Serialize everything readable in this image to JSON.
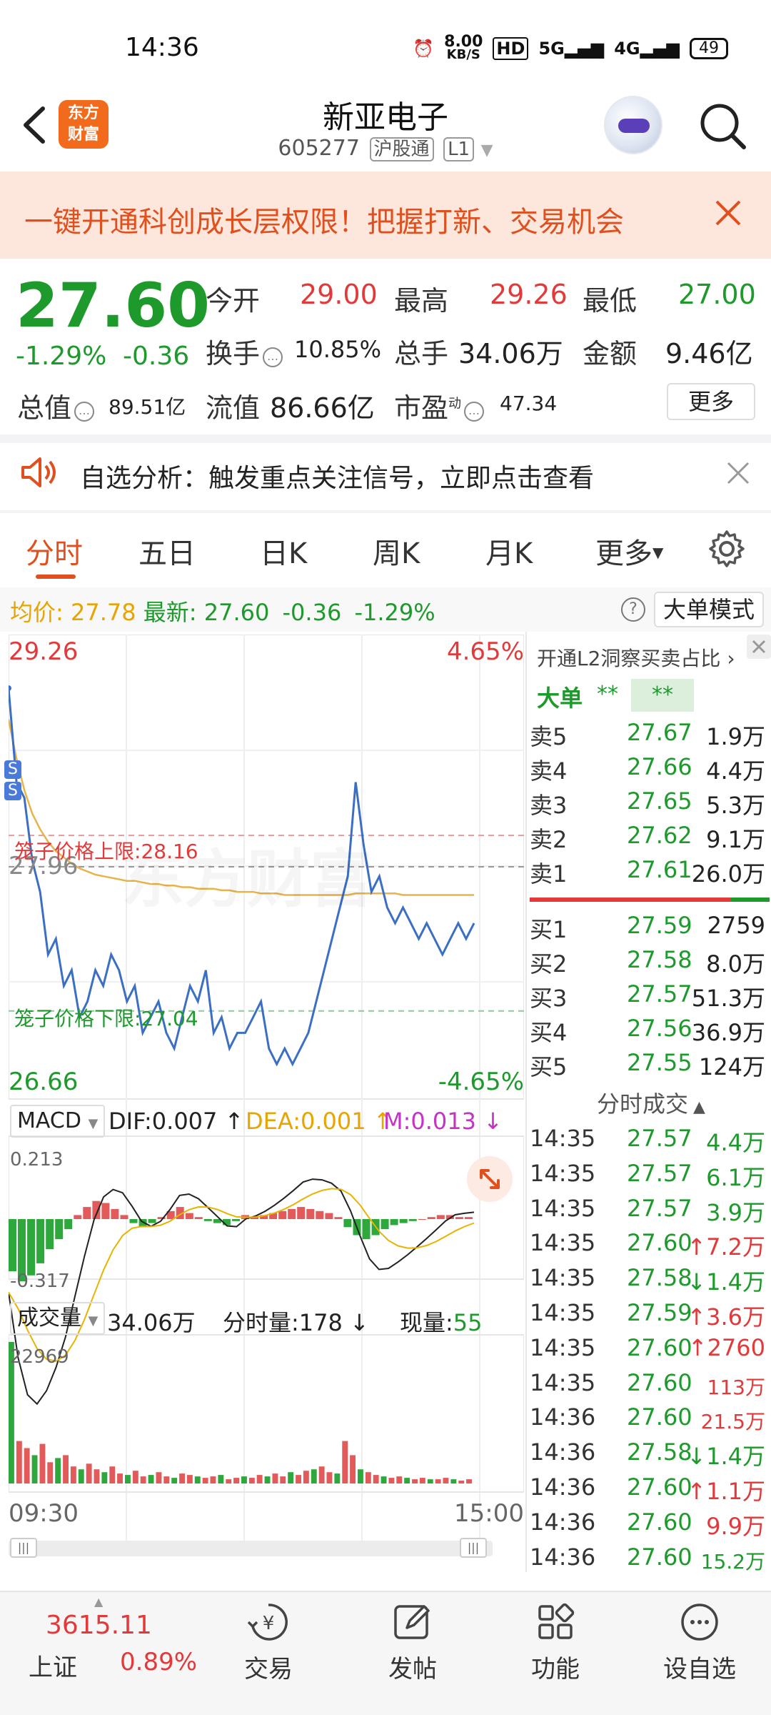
{
  "status_bar": {
    "time": "14:36",
    "net_speed_value": "8.00",
    "net_speed_unit": "KB/S",
    "hd_label": "HD",
    "signal_1": "5G",
    "signal_2": "4G",
    "battery": "49"
  },
  "header": {
    "logo_line1": "东方",
    "logo_line2": "财富",
    "stock_name": "新亚电子",
    "stock_code": "605277",
    "exchange_tag": "沪股通",
    "level_tag": "L1"
  },
  "promo_banner": {
    "text": "一键开通科创成长层权限！把握打新、交易机会"
  },
  "quote": {
    "price": "27.60",
    "change_pct": "-1.29%",
    "change": "-0.36",
    "open_label": "今开",
    "open": "29.00",
    "high_label": "最高",
    "high": "29.26",
    "low_label": "最低",
    "low": "27.00",
    "turnover_label": "换手",
    "turnover": "10.85%",
    "volume_label": "总手",
    "volume": "34.06万",
    "amount_label": "金额",
    "amount": "9.46亿",
    "market_cap_label": "总值",
    "market_cap": "89.51亿",
    "float_cap_label": "流值",
    "float_cap": "86.66亿",
    "pe_label": "市盈",
    "pe_sup": "动",
    "pe": "47.34",
    "more_label": "更多"
  },
  "notice": {
    "text": "自选分析：触发重点关注信号，立即点击查看"
  },
  "tabs": [
    "分时",
    "五日",
    "日K",
    "周K",
    "月K",
    "更多"
  ],
  "chart_info": {
    "avg_label": "均价:",
    "avg": "27.78",
    "latest_label": "最新:",
    "latest": "27.60",
    "change": "-0.36",
    "change_pct": "-1.29%",
    "mode_button": "大单模式"
  },
  "chart_data": {
    "type": "line",
    "series": [],
    "x_range": [
      "09:30",
      "15:00"
    ],
    "y_range": [
      26.66,
      29.26
    ],
    "y_pct_range": [
      "-4.65%",
      "4.65%"
    ],
    "ref_price": "27.96",
    "cage_upper_label": "笼子价格上限:",
    "cage_upper": "28.16",
    "cage_lower_label": "笼子价格下限:",
    "cage_lower": "27.04",
    "price": [
      29.1,
      28.5,
      28.4,
      28.0,
      27.8,
      27.4,
      27.5,
      27.2,
      27.3,
      27.0,
      27.1,
      27.3,
      27.2,
      27.4,
      27.3,
      27.1,
      27.2,
      26.9,
      27.0,
      27.1,
      26.9,
      26.8,
      27.0,
      27.2,
      27.1,
      27.3,
      26.9,
      27.0,
      26.8,
      26.9,
      26.9,
      27.0,
      27.1,
      26.8,
      26.7,
      26.8,
      26.7,
      26.8,
      26.9,
      27.1,
      27.3,
      27.5,
      27.7,
      27.9,
      28.5,
      28.1,
      27.8,
      27.9,
      27.7,
      27.6,
      27.7,
      27.6,
      27.5,
      27.6,
      27.5,
      27.4,
      27.5,
      27.6,
      27.5,
      27.6
    ],
    "average": [
      28.9,
      28.65,
      28.45,
      28.3,
      28.2,
      28.12,
      28.06,
      28.02,
      27.98,
      27.95,
      27.93,
      27.91,
      27.9,
      27.89,
      27.88,
      27.87,
      27.87,
      27.86,
      27.85,
      27.85,
      27.84,
      27.84,
      27.83,
      27.83,
      27.82,
      27.82,
      27.82,
      27.81,
      27.81,
      27.8,
      27.8,
      27.8,
      27.79,
      27.79,
      27.79,
      27.78,
      27.78,
      27.78,
      27.78,
      27.78,
      27.78,
      27.78,
      27.78,
      27.78,
      27.79,
      27.79,
      27.79,
      27.79,
      27.79,
      27.79,
      27.78,
      27.78,
      27.78,
      27.78,
      27.78,
      27.78,
      27.78,
      27.78,
      27.78,
      27.78
    ]
  },
  "macd": {
    "selector_label": "MACD",
    "dif_label": "DIF:0.007",
    "dea_label": "DEA:0.001",
    "m_label": "M:0.013",
    "max": "0.213",
    "min": "-0.317",
    "bars": [
      -0.26,
      -0.31,
      -0.28,
      -0.22,
      -0.15,
      -0.1,
      -0.05,
      0.02,
      0.06,
      0.09,
      0.08,
      0.05,
      0.02,
      -0.02,
      -0.04,
      -0.02,
      0.01,
      0.04,
      0.06,
      0.03,
      0.01,
      -0.01,
      -0.02,
      -0.03,
      -0.01,
      0.02,
      0.01,
      0.02,
      0.03,
      0.04,
      0.05,
      0.06,
      0.05,
      0.04,
      0.03,
      0.01,
      -0.04,
      -0.08,
      -0.1,
      -0.08,
      -0.05,
      -0.03,
      -0.02,
      -0.01,
      0.0,
      0.01,
      0.02,
      0.02,
      0.01,
      0.01
    ]
  },
  "volume": {
    "selector_label": "成交量",
    "total": "34.06万",
    "period_label": "分时量:178",
    "now_label": "现量:",
    "now": "55",
    "max": "22969",
    "time_start": "09:30",
    "time_end": "15:00",
    "bars": [
      1.0,
      0.3,
      0.25,
      0.2,
      0.28,
      0.15,
      0.18,
      0.2,
      0.12,
      0.1,
      0.14,
      0.1,
      0.08,
      0.12,
      0.07,
      0.06,
      0.09,
      0.05,
      0.06,
      0.08,
      0.05,
      0.04,
      0.07,
      0.06,
      0.05,
      0.04,
      0.05,
      0.06,
      0.03,
      0.04,
      0.05,
      0.04,
      0.06,
      0.05,
      0.07,
      0.05,
      0.08,
      0.06,
      0.09,
      0.1,
      0.12,
      0.08,
      0.07,
      0.3,
      0.2,
      0.1,
      0.08,
      0.06,
      0.05,
      0.04,
      0.05,
      0.04,
      0.03,
      0.04,
      0.03,
      0.03,
      0.04,
      0.03,
      0.02,
      0.03
    ]
  },
  "right_panel": {
    "l2_banner": "开通L2洞察买卖占比",
    "bigorder_label": "大单",
    "bigorder_v1": "**",
    "bigorder_v2": "**",
    "asks": [
      {
        "label": "卖5",
        "price": "27.67",
        "vol": "1.9万"
      },
      {
        "label": "卖4",
        "price": "27.66",
        "vol": "4.4万"
      },
      {
        "label": "卖3",
        "price": "27.65",
        "vol": "5.3万"
      },
      {
        "label": "卖2",
        "price": "27.62",
        "vol": "9.1万"
      },
      {
        "label": "卖1",
        "price": "27.61",
        "vol": "26.0万"
      }
    ],
    "bids": [
      {
        "label": "买1",
        "price": "27.59",
        "vol": "2759"
      },
      {
        "label": "买2",
        "price": "27.58",
        "vol": "8.0万"
      },
      {
        "label": "买3",
        "price": "27.57",
        "vol": "51.3万"
      },
      {
        "label": "买4",
        "price": "27.56",
        "vol": "36.9万"
      },
      {
        "label": "买5",
        "price": "27.55",
        "vol": "124万"
      }
    ],
    "trades_header": "分时成交",
    "trades": [
      {
        "time": "14:35",
        "price": "27.57",
        "vol": "4.4万",
        "dir": "",
        "color": "#1e9a2c",
        "small": false
      },
      {
        "time": "14:35",
        "price": "27.57",
        "vol": "6.1万",
        "dir": "",
        "color": "#1e9a2c",
        "small": false
      },
      {
        "time": "14:35",
        "price": "27.57",
        "vol": "3.9万",
        "dir": "",
        "color": "#1e9a2c",
        "small": false
      },
      {
        "time": "14:35",
        "price": "27.60",
        "vol": "7.2万",
        "dir": "↑",
        "color": "#e23a3a",
        "small": false
      },
      {
        "time": "14:35",
        "price": "27.58",
        "vol": "1.4万",
        "dir": "↓",
        "color": "#1e9a2c",
        "small": false
      },
      {
        "time": "14:35",
        "price": "27.59",
        "vol": "3.6万",
        "dir": "↑",
        "color": "#e23a3a",
        "small": false
      },
      {
        "time": "14:35",
        "price": "27.60",
        "vol": "2760",
        "dir": "↑",
        "color": "#e23a3a",
        "small": false
      },
      {
        "time": "14:35",
        "price": "27.60",
        "vol": "113万",
        "dir": "",
        "color": "#e23a3a",
        "small": true
      },
      {
        "time": "14:36",
        "price": "27.60",
        "vol": "21.5万",
        "dir": "",
        "color": "#e23a3a",
        "small": true
      },
      {
        "time": "14:36",
        "price": "27.58",
        "vol": "1.4万",
        "dir": "↓",
        "color": "#1e9a2c",
        "small": false
      },
      {
        "time": "14:36",
        "price": "27.60",
        "vol": "1.1万",
        "dir": "↑",
        "color": "#e23a3a",
        "small": false
      },
      {
        "time": "14:36",
        "price": "27.60",
        "vol": "9.9万",
        "dir": "",
        "color": "#e23a3a",
        "small": false
      },
      {
        "time": "14:36",
        "price": "27.60",
        "vol": "15.2万",
        "dir": "",
        "color": "#1e9a2c",
        "small": true
      }
    ]
  },
  "bottom_nav": {
    "index_value": "3615.11",
    "index_name": "上证",
    "index_pct": "0.89%",
    "items": [
      {
        "label": "交易",
        "icon": "trade-icon"
      },
      {
        "label": "发帖",
        "icon": "post-icon"
      },
      {
        "label": "功能",
        "icon": "function-icon"
      },
      {
        "label": "设自选",
        "icon": "add-watchlist-icon"
      }
    ]
  },
  "colors": {
    "up": "#e23a3a",
    "down": "#1e9a2c",
    "accent": "#e0501e",
    "price_line": "#3a6fc4",
    "avg_line": "#e8b44a"
  }
}
